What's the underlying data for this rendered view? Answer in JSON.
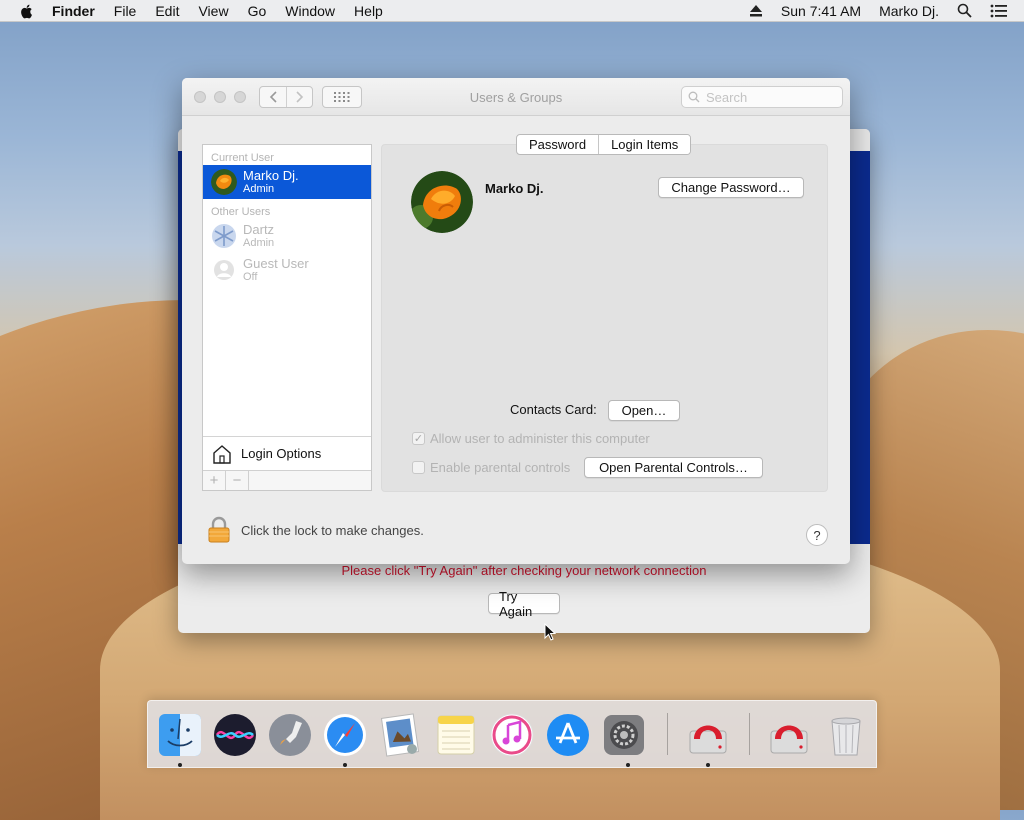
{
  "menubar": {
    "app": "Finder",
    "items": [
      "File",
      "Edit",
      "View",
      "Go",
      "Window",
      "Help"
    ],
    "clock": "Sun 7:41 AM",
    "user": "Marko Dj."
  },
  "back_window": {
    "error": "Please click \"Try Again\" after checking your network connection",
    "retry_label": "Try Again",
    "error_color": "#d0142e"
  },
  "window": {
    "title": "Users & Groups",
    "search_placeholder": "Search",
    "tabs": [
      "Password",
      "Login Items"
    ],
    "sidebar": {
      "current_header": "Current User",
      "current_user": {
        "name": "Marko Dj.",
        "role": "Admin"
      },
      "other_header": "Other Users",
      "others": [
        {
          "name": "Dartz",
          "role": "Admin"
        },
        {
          "name": "Guest User",
          "role": "Off"
        }
      ],
      "login_options": "Login Options",
      "add": "+",
      "remove": "−"
    },
    "detail": {
      "username": "Marko Dj.",
      "change_password": "Change Password…",
      "contacts_label": "Contacts Card:",
      "open_label": "Open…",
      "allow_admin": "Allow user to administer this computer",
      "allow_admin_checked": true,
      "parental": "Enable parental controls",
      "parental_checked": false,
      "open_parental": "Open Parental Controls…"
    },
    "lock_text": "Click the lock to make changes.",
    "help": "?"
  },
  "colors": {
    "selection": "#0b58d8",
    "blue_band": "#0b2b8f"
  }
}
